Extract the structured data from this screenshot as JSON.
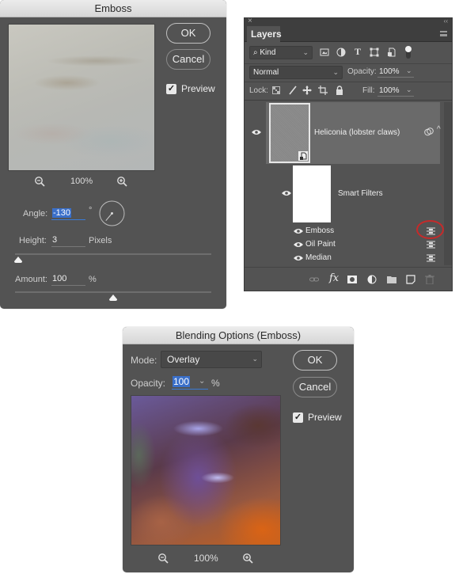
{
  "emboss_dialog": {
    "title": "Emboss",
    "ok_label": "OK",
    "cancel_label": "Cancel",
    "preview_label": "Preview",
    "preview_checked": true,
    "zoom_level": "100%",
    "angle_label": "Angle:",
    "angle_value": "-130",
    "angle_unit": "°",
    "height_label": "Height:",
    "height_value": "3",
    "height_unit": "Pixels",
    "height_slider_value": 3,
    "amount_label": "Amount:",
    "amount_value": "100",
    "amount_unit": "%",
    "amount_slider_percent": 50
  },
  "layers_panel": {
    "close_glyph": "×",
    "collapse_glyph": "‹‹",
    "tab_label": "Layers",
    "filter_kind": "Kind",
    "blend_mode": "Normal",
    "opacity_label": "Opacity:",
    "opacity_value": "100%",
    "lock_label": "Lock:",
    "fill_label": "Fill:",
    "fill_value": "100%",
    "layer_name": "Heliconia (lobster claws)",
    "smart_filters_label": "Smart Filters",
    "filters": [
      {
        "name": "Emboss"
      },
      {
        "name": "Oil Paint"
      },
      {
        "name": "Median"
      }
    ],
    "highlight_color": "#c62a2a"
  },
  "blending_dialog": {
    "title": "Blending Options (Emboss)",
    "mode_label": "Mode:",
    "mode_value": "Overlay",
    "opacity_label": "Opacity:",
    "opacity_value": "100",
    "opacity_unit": "%",
    "ok_label": "OK",
    "cancel_label": "Cancel",
    "preview_label": "Preview",
    "preview_checked": true,
    "zoom_level": "100%"
  }
}
